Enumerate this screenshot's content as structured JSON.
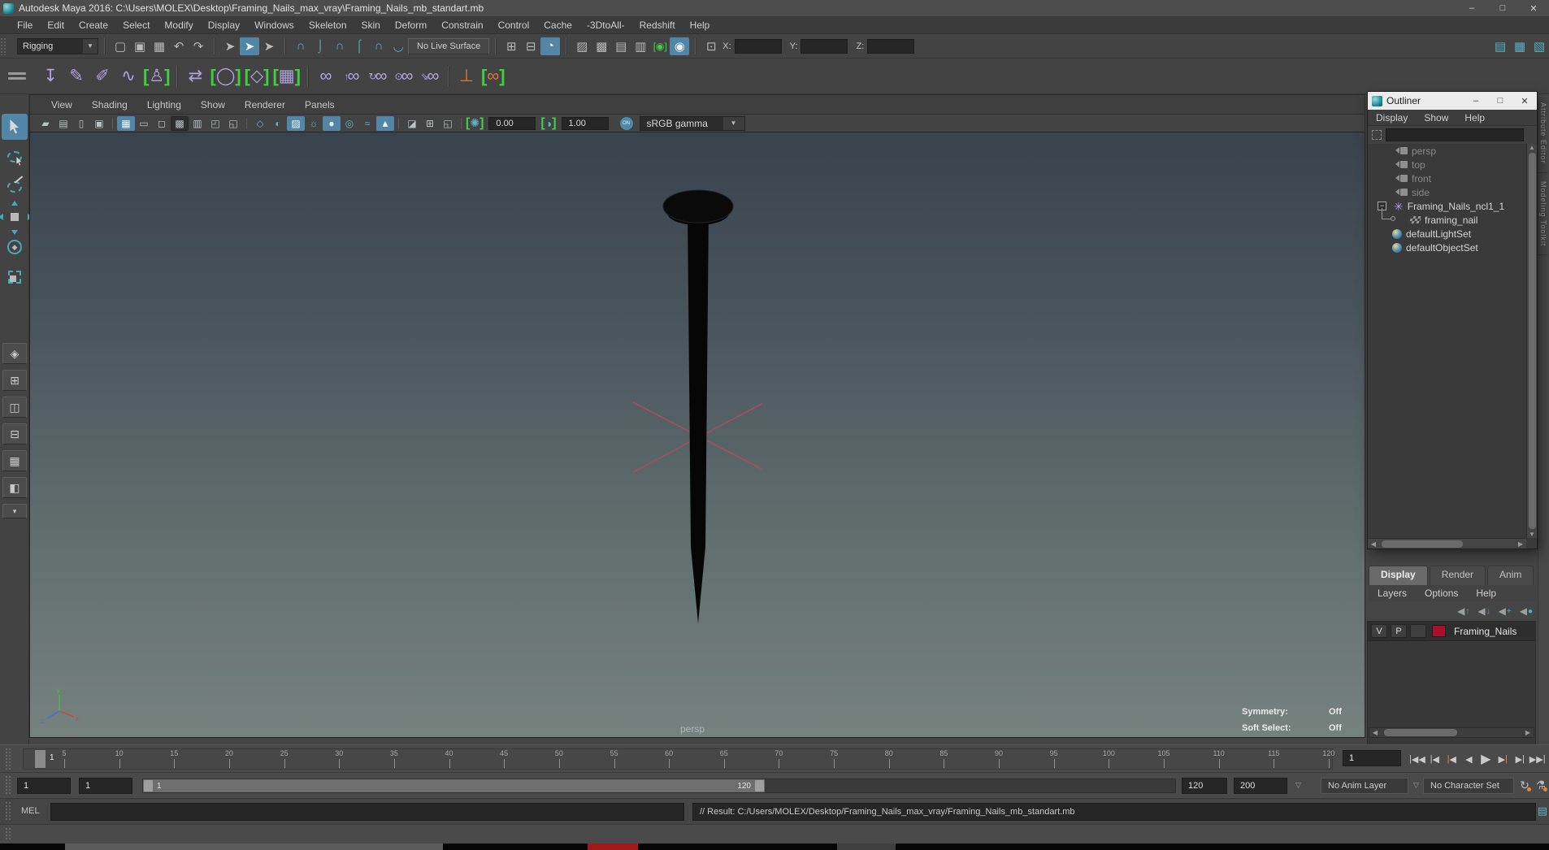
{
  "window": {
    "title": "Autodesk Maya 2016: C:\\Users\\MOLEX\\Desktop\\Framing_Nails_max_vray\\Framing_Nails_mb_standart.mb",
    "controls": [
      "minimize",
      "maximize",
      "close"
    ]
  },
  "menu_bar": {
    "items": [
      "File",
      "Edit",
      "Create",
      "Select",
      "Modify",
      "Display",
      "Windows",
      "Skeleton",
      "Skin",
      "Deform",
      "Constrain",
      "Control",
      "Cache",
      "-3DtoAll-",
      "Redshift",
      "Help"
    ]
  },
  "toolbar": {
    "menu_set": "Rigging",
    "live_surface": "No Live Surface",
    "axis_labels": {
      "x": "X:",
      "y": "Y:",
      "z": "Z:"
    },
    "axis_values": {
      "x": "",
      "y": "",
      "z": ""
    },
    "icons": [
      "new-scene",
      "open-scene",
      "save-scene",
      "undo",
      "redo",
      "select-hierarchy",
      "select-object",
      "select-component",
      "snap-grid",
      "snap-curve",
      "snap-point",
      "snap-projected-center",
      "snap-view-plane",
      "make-live",
      "input-connections",
      "output-connections",
      "construction-history",
      "batch-render",
      "render-settings",
      "render-current-frame",
      "ipr-render",
      "show-manipulators"
    ]
  },
  "shelf": {
    "items": [
      "joint-tool",
      "ik-handle-tool",
      "insert-joint-tool",
      "spline-ik-tool",
      "humanik",
      "mirror-joint",
      "nurbs-circle",
      "polygon-cube",
      "joint-grid",
      "parent-constraint",
      "point-constraint",
      "orient-constraint",
      "aim-constraint",
      "pole-vector-constraint",
      "distance-tool",
      "constraint-chain"
    ]
  },
  "toolbox": {
    "tools": [
      "select-tool",
      "lasso-tool",
      "paint-select-tool",
      "move-tool",
      "rotate-tool",
      "scale-tool"
    ],
    "layouts": [
      "four-view-layout",
      "persp-outliner-layout",
      "vertical-split-layout",
      "horizontal-split-layout",
      "hypershade-persp-layout",
      "graph-persp-layout",
      "layout-dropdown"
    ]
  },
  "viewport": {
    "menus": [
      "View",
      "Shading",
      "Lighting",
      "Show",
      "Renderer",
      "Panels"
    ],
    "iconbar": [
      "select-camera",
      "camera-attributes",
      "camera-bookmark",
      "image-plane",
      "grid",
      "film-gate",
      "resolution-gate",
      "gate-mask",
      "field-chart",
      "safe-action",
      "safe-title",
      "wireframe",
      "shaded",
      "textured",
      "use-all-lights",
      "shadows",
      "screen-space-ao",
      "motion-blur",
      "anti-aliasing",
      "isolate-select",
      "pan-zoom",
      "zoom-region"
    ],
    "exposure": "0.00",
    "contrast": "1.00",
    "gamma_toggle": "ON",
    "gamma": "sRGB gamma",
    "camera_label": "persp",
    "overlay": {
      "symmetry_label": "Symmetry:",
      "symmetry_value": "Off",
      "soft_select_label": "Soft Select:",
      "soft_select_value": "Off"
    }
  },
  "outliner": {
    "title": "Outliner",
    "menus": [
      "Display",
      "Show",
      "Help"
    ],
    "search_value": "",
    "items": [
      {
        "label": "persp",
        "icon": "camera-icon",
        "dim": true
      },
      {
        "label": "top",
        "icon": "camera-icon",
        "dim": true
      },
      {
        "label": "front",
        "icon": "camera-icon",
        "dim": true
      },
      {
        "label": "side",
        "icon": "camera-icon",
        "dim": true
      },
      {
        "label": "Framing_Nails_ncl1_1",
        "icon": "nucleus-icon",
        "expanded": true
      },
      {
        "label": "framing_nail",
        "icon": "mesh-icon",
        "child": true
      },
      {
        "label": "defaultLightSet",
        "icon": "set-icon"
      },
      {
        "label": "defaultObjectSet",
        "icon": "set-icon"
      }
    ]
  },
  "layer_editor": {
    "tabs": [
      "Display",
      "Render",
      "Anim"
    ],
    "active_tab": "Display",
    "menus": [
      "Layers",
      "Options",
      "Help"
    ],
    "icons": [
      "move-layer-up",
      "move-layer-down",
      "create-empty-layer",
      "create-layer-from-selected"
    ],
    "layers": [
      {
        "visible": "V",
        "playback": "P",
        "name": "Framing_Nails",
        "color": "#a8102e"
      }
    ]
  },
  "timeline": {
    "current_frame": "1",
    "ticks": [
      5,
      10,
      15,
      20,
      25,
      30,
      35,
      40,
      45,
      50,
      55,
      60,
      65,
      70,
      75,
      80,
      85,
      90,
      95,
      100,
      105,
      110,
      115,
      120
    ],
    "time_field": "1",
    "playback": [
      "go-to-start",
      "step-back-key",
      "step-back-frame",
      "play-backwards",
      "play-forward",
      "step-forward-frame",
      "step-forward-key",
      "go-to-end"
    ]
  },
  "range_slider": {
    "playback_start": "1",
    "anim_start": "1",
    "handle_start": "1",
    "handle_end": "120",
    "playback_end": "120",
    "anim_end": "200",
    "anim_layer": "No Anim Layer",
    "character_set": "No Character Set"
  },
  "command_line": {
    "label": "MEL",
    "input_value": "",
    "result": "// Result: C:/Users/MOLEX/Desktop/Framing_Nails_max_vray/Framing_Nails_mb_standart.mb"
  },
  "side_tabs": [
    "Attribute Editor",
    "Modeling Toolkit"
  ],
  "colors": {
    "accent_blue": "#5285a6",
    "teal": "#4fb0c0",
    "shelf_purple": "#b3a3de",
    "bracket_green": "#3ed13e",
    "orange": "#e0763a",
    "layer_color": "#a8102e",
    "selection_pink": "#b5495e"
  }
}
